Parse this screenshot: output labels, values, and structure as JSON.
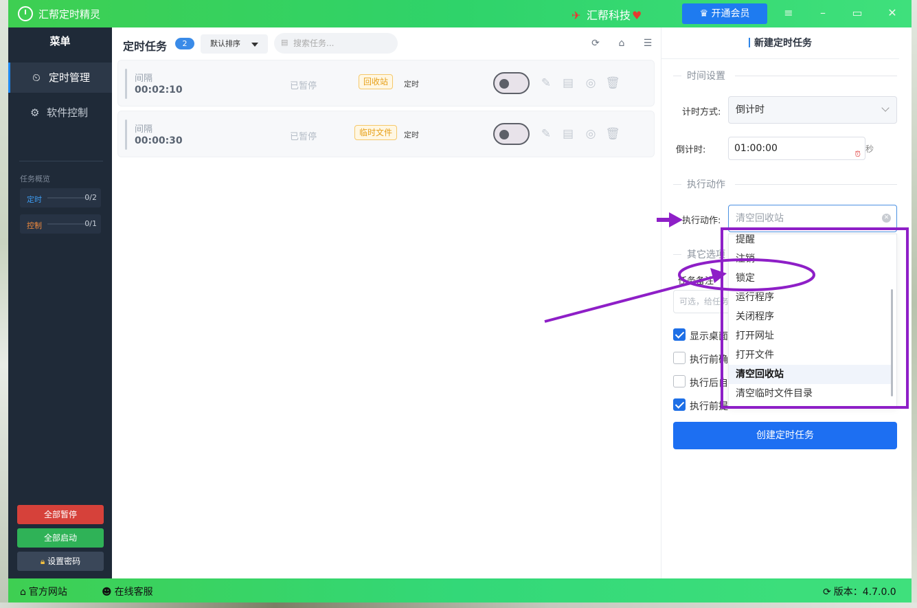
{
  "window": {
    "app_title": "汇帮定时精灵",
    "brand": "汇帮科技",
    "vip_button": "开通会员"
  },
  "sidebar": {
    "menu_title": "菜单",
    "nav": [
      {
        "label": "定时管理",
        "icon": "clock-icon",
        "active": true
      },
      {
        "label": "软件控制",
        "icon": "gear-icon",
        "active": false
      }
    ],
    "overview_label": "任务概览",
    "overview": [
      {
        "label": "定时",
        "count": "0/2",
        "color": "#3d9bf0"
      },
      {
        "label": "控制",
        "count": "0/1",
        "color": "#f08a3d"
      }
    ],
    "buttons": {
      "pause_all": "全部暂停",
      "start_all": "全部启动",
      "set_password": "设置密码"
    }
  },
  "task_list": {
    "title": "定时任务",
    "count": "2",
    "sort": "默认排序",
    "search_placeholder": "搜索任务...",
    "rows": [
      {
        "label": "间隔",
        "time": "00:02:10",
        "status": "已暂停",
        "tag": "回收站",
        "type": "定时"
      },
      {
        "label": "间隔",
        "time": "00:00:30",
        "status": "已暂停",
        "tag": "临时文件",
        "type": "定时"
      }
    ]
  },
  "panel": {
    "title": "新建定时任务",
    "time_section": "时间设置",
    "mode_label": "计时方式:",
    "mode_value": "倒计时",
    "countdown_label": "倒计时:",
    "countdown_value": "01:00:00",
    "countdown_unit": "秒",
    "action_section": "执行动作",
    "action_label": "执行动作:",
    "action_value": "清空回收站",
    "other_section": "其它选项",
    "note_label": "任务备注",
    "note_placeholder": "可选，给任务",
    "checkboxes": [
      {
        "label": "显示桌面",
        "checked": true
      },
      {
        "label": "执行前确",
        "checked": false
      },
      {
        "label": "执行后自",
        "checked": false
      },
      {
        "label": "执行前提",
        "checked": true
      }
    ],
    "create_button": "创建定时任务"
  },
  "dropdown": {
    "items": [
      "提醒",
      "注销",
      "锁定",
      "运行程序",
      "关闭程序",
      "打开网址",
      "打开文件",
      "清空回收站",
      "清空临时文件目录"
    ],
    "selected": "清空回收站"
  },
  "bottombar": {
    "website": "官方网站",
    "support": "在线客服",
    "version": "版本：4.7.0.0"
  },
  "colors": {
    "accent_green": "#3ecf52",
    "primary_blue": "#1d6ff2",
    "annotation_purple": "#8e1fc7"
  }
}
